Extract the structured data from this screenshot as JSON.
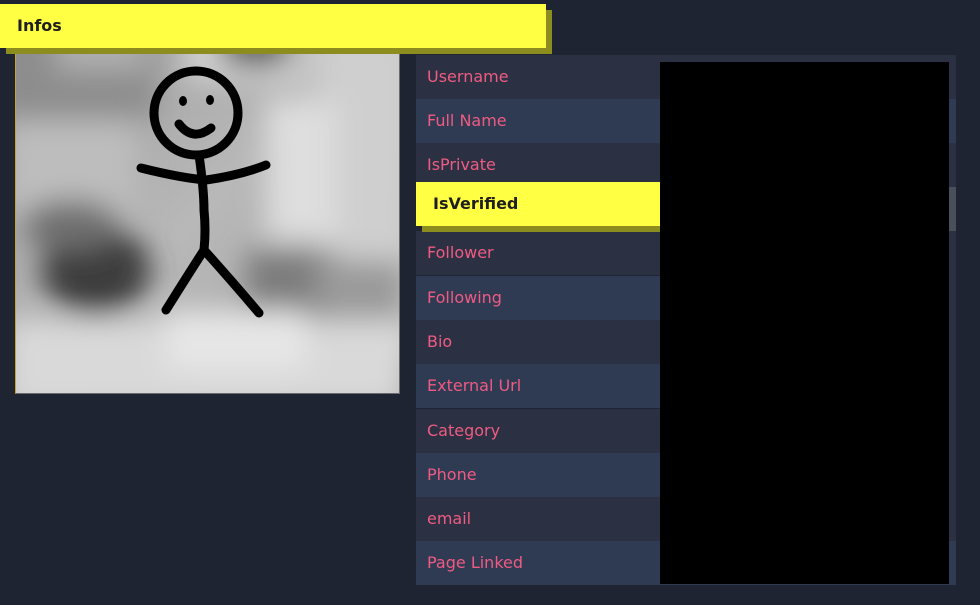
{
  "header": {
    "infos_label": "Infos",
    "verified_label": "IsVerified"
  },
  "fields": {
    "username": "Username",
    "full_name": "Full Name",
    "is_private": "IsPrivate",
    "follower": "Follower",
    "following": "Following",
    "bio": "Bio",
    "external_url": "External Url",
    "category": "Category",
    "phone": "Phone",
    "email": "email",
    "page_linked": "Page Linked"
  },
  "colors": {
    "background": "#1f2433",
    "header_yellow": "#ffff44",
    "label_pink": "#ef5b83",
    "row_dark": "#2b3142",
    "row_light": "#2f3a53",
    "redaction": "#000000"
  },
  "image": {
    "content": "stick-figure-avatar"
  }
}
